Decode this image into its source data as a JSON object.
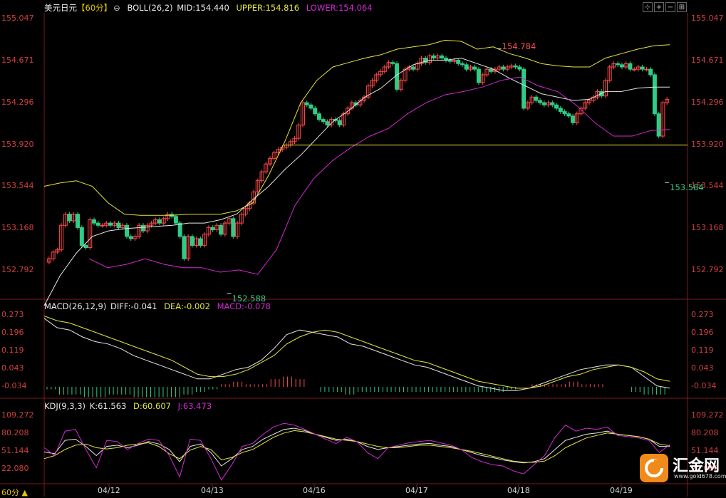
{
  "header": {
    "symbol": "美元日元",
    "period": "【60分】",
    "boll": "BOLL(26,2)",
    "mid": "MID:154.440",
    "upper": "UPPER:154.816",
    "lower": "LOWER:154.064"
  },
  "macd_header": {
    "name": "MACD(26,12,9)",
    "diff": "DIFF:-0.041",
    "dea": "DEA:-0.002",
    "macd": "MACD:-0.078"
  },
  "kdj_header": {
    "name": "KDJ(9,3,3)",
    "k": "K:61.563",
    "d": "D:60.607",
    "j": "J:63.473"
  },
  "period_selector": "60分",
  "logo": {
    "name": "汇金网",
    "url": "www.gold678.com"
  },
  "colors": {
    "up": "#ff4a4a",
    "down": "#2fcc86",
    "mid": "#e6e6e6",
    "upper": "#e6e63c",
    "lower": "#d22ad2",
    "grid": "#7a1c1c",
    "axis": "#d04040"
  },
  "chart_data": [
    {
      "type": "candlestick",
      "title": "美元日元【60分】",
      "y_ticks": [
        "155.047",
        "154.671",
        "154.296",
        "153.920",
        "153.544",
        "153.168",
        "152.792"
      ],
      "x_ticks": [
        "04/12",
        "04/13",
        "04/16",
        "04/17",
        "04/18",
        "04/19"
      ],
      "ylim": [
        152.55,
        155.08
      ],
      "annotations": [
        {
          "label": "154.784",
          "x": 110,
          "y": 154.784
        },
        {
          "label": "152.588",
          "x": 44,
          "y": 152.588
        },
        {
          "label": "153.584",
          "x": 183,
          "y": 153.584
        }
      ],
      "reference_line": 153.92,
      "closes": [
        152.9,
        152.96,
        152.98,
        153.2,
        153.3,
        153.24,
        153.3,
        153.18,
        153.02,
        153.0,
        153.25,
        153.22,
        153.2,
        153.2,
        153.22,
        153.2,
        153.22,
        153.18,
        153.2,
        153.1,
        153.08,
        153.1,
        153.2,
        153.15,
        153.2,
        153.22,
        153.25,
        153.22,
        153.26,
        153.3,
        153.28,
        153.22,
        153.1,
        152.9,
        153.1,
        153.02,
        153.08,
        153.02,
        153.12,
        153.18,
        153.16,
        153.2,
        153.12,
        153.22,
        153.26,
        153.1,
        153.22,
        153.3,
        153.35,
        153.4,
        153.5,
        153.6,
        153.68,
        153.75,
        153.8,
        153.85,
        153.88,
        153.9,
        153.92,
        153.95,
        153.98,
        154.1,
        154.3,
        154.28,
        154.25,
        154.2,
        154.15,
        154.13,
        154.1,
        154.15,
        154.14,
        154.1,
        154.2,
        154.25,
        154.3,
        154.28,
        154.32,
        154.35,
        154.45,
        154.5,
        154.55,
        154.58,
        154.62,
        154.66,
        154.65,
        154.42,
        154.5,
        154.6,
        154.62,
        154.6,
        154.65,
        154.7,
        154.66,
        154.72,
        154.7,
        154.72,
        154.7,
        154.68,
        154.67,
        154.68,
        154.65,
        154.64,
        154.6,
        154.62,
        154.6,
        154.48,
        154.55,
        154.6,
        154.58,
        154.6,
        154.62,
        154.6,
        154.62,
        154.63,
        154.62,
        154.6,
        154.25,
        154.3,
        154.35,
        154.32,
        154.3,
        154.28,
        154.3,
        154.28,
        154.25,
        154.22,
        154.2,
        154.18,
        154.12,
        154.2,
        154.25,
        154.3,
        154.32,
        154.35,
        154.4,
        154.36,
        154.5,
        154.62,
        154.65,
        154.64,
        154.62,
        154.65,
        154.6,
        154.6,
        154.62,
        154.6,
        154.6,
        154.55,
        154.2,
        154.0,
        154.3,
        154.33
      ],
      "boll_upper": [
        153.55,
        153.58,
        153.6,
        153.55,
        153.4,
        153.3,
        153.29,
        153.29,
        153.29,
        153.3,
        153.3,
        153.3,
        153.33,
        153.4,
        153.65,
        153.95,
        154.3,
        154.5,
        154.62,
        154.66,
        154.7,
        154.73,
        154.78,
        154.8,
        154.82,
        154.86,
        154.85,
        154.78,
        154.8,
        154.74,
        154.7,
        154.65,
        154.63,
        154.62,
        154.62,
        154.7,
        154.74,
        154.78,
        154.81,
        154.82
      ],
      "boll_mid": [
        152.48,
        152.75,
        152.95,
        153.1,
        153.15,
        153.17,
        153.18,
        153.19,
        153.2,
        153.22,
        153.22,
        153.25,
        153.3,
        153.43,
        153.55,
        153.7,
        153.83,
        153.98,
        154.13,
        154.23,
        154.35,
        154.43,
        154.55,
        154.64,
        154.68,
        154.68,
        154.7,
        154.65,
        154.6,
        154.52,
        154.45,
        154.38,
        154.35,
        154.32,
        154.33,
        154.4,
        154.4,
        154.43,
        154.44,
        154.44
      ],
      "boll_lower": [
        152.9,
        152.82,
        152.85,
        152.9,
        152.85,
        152.82,
        152.82,
        152.78,
        152.8,
        152.76,
        152.98,
        153.38,
        153.62,
        153.78,
        153.9,
        154.0,
        154.07,
        154.2,
        154.3,
        154.37,
        154.4,
        154.44,
        154.5,
        154.53,
        154.45,
        154.4,
        154.28,
        154.12,
        154.0,
        154.0,
        154.05,
        154.06
      ]
    },
    {
      "type": "macd",
      "y_ticks": [
        "0.273",
        "0.196",
        "0.119",
        "0.043",
        "-0.034"
      ],
      "ylim": [
        -0.08,
        0.29
      ],
      "diff": [
        0.26,
        0.22,
        0.21,
        0.18,
        0.16,
        0.15,
        0.13,
        0.1,
        0.08,
        0.06,
        0.04,
        0.02,
        0.0,
        0.0,
        0.02,
        0.04,
        0.05,
        0.08,
        0.13,
        0.19,
        0.21,
        0.2,
        0.19,
        0.18,
        0.15,
        0.14,
        0.12,
        0.1,
        0.08,
        0.06,
        0.05,
        0.03,
        0.01,
        -0.01,
        -0.03,
        -0.04,
        -0.05,
        -0.05,
        -0.04,
        -0.02,
        0.0,
        0.02,
        0.04,
        0.05,
        0.06,
        0.06,
        0.05,
        0.01,
        -0.03,
        -0.04
      ],
      "dea": [
        0.27,
        0.25,
        0.24,
        0.22,
        0.2,
        0.18,
        0.16,
        0.14,
        0.12,
        0.1,
        0.08,
        0.05,
        0.02,
        0.01,
        0.01,
        0.02,
        0.04,
        0.07,
        0.1,
        0.15,
        0.18,
        0.2,
        0.21,
        0.2,
        0.18,
        0.16,
        0.14,
        0.12,
        0.1,
        0.08,
        0.07,
        0.05,
        0.03,
        0.01,
        -0.01,
        -0.02,
        -0.03,
        -0.04,
        -0.04,
        -0.03,
        -0.01,
        0.01,
        0.02,
        0.04,
        0.05,
        0.06,
        0.05,
        0.03,
        0.0,
        -0.01
      ]
    },
    {
      "type": "kdj",
      "y_ticks": [
        "109.272",
        "80.208",
        "51.144",
        "22.080"
      ],
      "ylim": [
        0,
        118
      ],
      "k": [
        51,
        48,
        70,
        72,
        60,
        45,
        60,
        62,
        58,
        62,
        68,
        64,
        55,
        35,
        60,
        64,
        50,
        28,
        40,
        55,
        60,
        72,
        80,
        88,
        90,
        86,
        80,
        75,
        70,
        72,
        68,
        60,
        55,
        58,
        60,
        62,
        64,
        65,
        62,
        60,
        55,
        50,
        45,
        42,
        38,
        35,
        33,
        35,
        40,
        55,
        70,
        75,
        80,
        82,
        85,
        80,
        78,
        76,
        72,
        60,
        60
      ],
      "d": [
        40,
        45,
        55,
        62,
        64,
        58,
        56,
        58,
        62,
        64,
        66,
        60,
        48,
        40,
        54,
        60,
        55,
        38,
        42,
        50,
        55,
        65,
        75,
        82,
        86,
        84,
        80,
        76,
        72,
        70,
        68,
        64,
        60,
        58,
        58,
        60,
        62,
        62,
        60,
        58,
        55,
        52,
        48,
        44,
        40,
        36,
        34,
        34,
        36,
        45,
        58,
        66,
        74,
        78,
        82,
        80,
        78,
        76,
        72,
        64,
        61
      ],
      "j": [
        58,
        45,
        85,
        88,
        55,
        25,
        70,
        68,
        55,
        65,
        72,
        70,
        45,
        10,
        72,
        70,
        40,
        5,
        30,
        60,
        65,
        80,
        92,
        98,
        95,
        88,
        80,
        72,
        65,
        75,
        68,
        50,
        40,
        58,
        62,
        66,
        68,
        70,
        66,
        62,
        55,
        42,
        35,
        30,
        28,
        20,
        15,
        30,
        45,
        75,
        95,
        85,
        90,
        88,
        92,
        78,
        76,
        74,
        70,
        50,
        63
      ]
    }
  ]
}
